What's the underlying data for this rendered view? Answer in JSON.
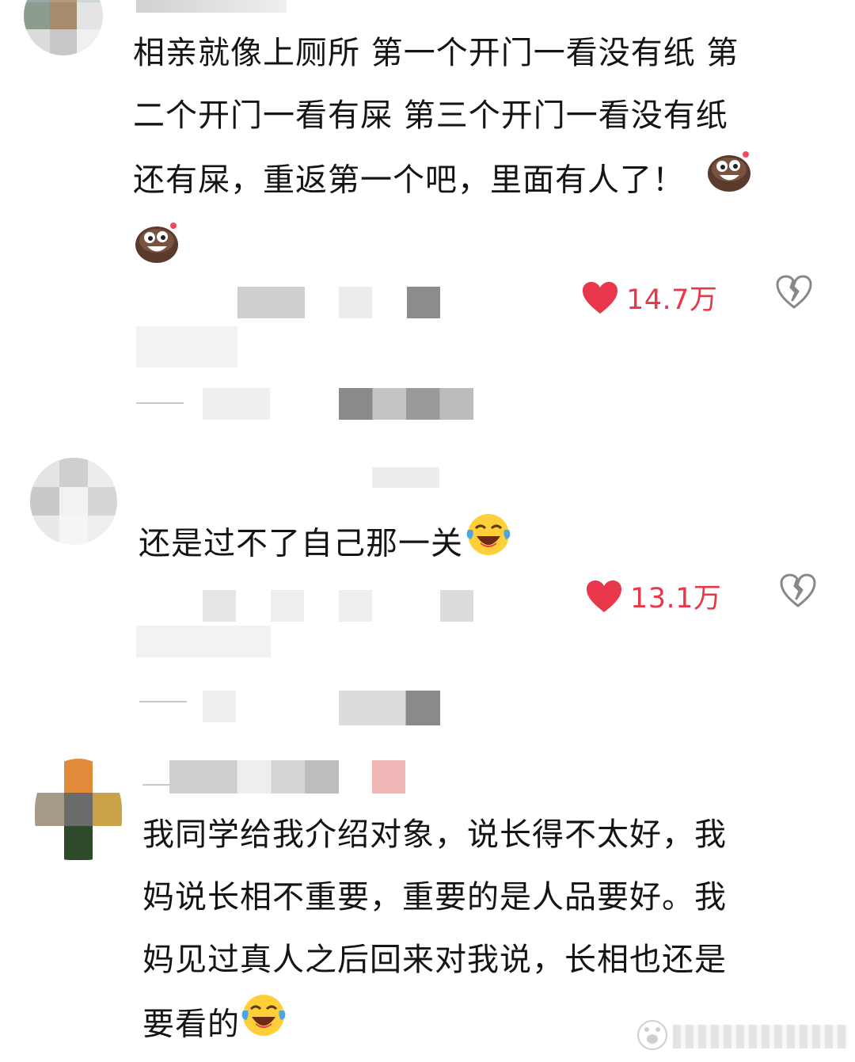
{
  "comments": [
    {
      "lines": [
        "相亲就像上厕所 第一个开门一看没有纸 第",
        "二个开门一看有屎 第三个开门一看没有纸",
        "还有屎，重返第一个吧，里面有人了！"
      ],
      "likes": "14.7万",
      "emoji_icon": "grin-face-icon"
    },
    {
      "lines": [
        "还是过不了自己那一关"
      ],
      "likes": "13.1万",
      "emoji_icon": "laugh-cry-face-icon"
    },
    {
      "lines": [
        "我同学给我介绍对象，说长得不太好，我",
        "妈说长相不重要，重要的是人品要好。我",
        "妈见过真人之后回来对我说，长相也还是",
        "要看的"
      ],
      "emoji_icon": "laugh-cry-face-icon"
    }
  ],
  "colors": {
    "like_red": "#e8374a",
    "text": "#141414",
    "muted": "#c9c9c9"
  }
}
